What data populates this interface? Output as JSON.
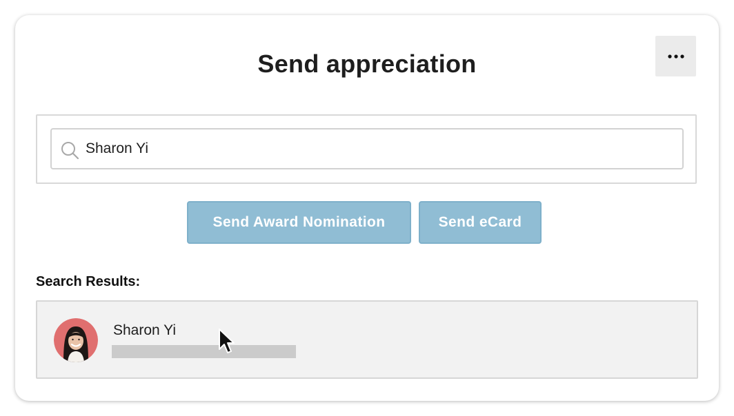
{
  "dialog": {
    "title": "Send appreciation",
    "more_icon": "ellipsis-icon"
  },
  "search": {
    "value": "Sharon Yi",
    "icon": "search-icon"
  },
  "actions": {
    "award_label": "Send Award Nomination",
    "ecard_label": "Send eCard",
    "button_color": "#90bdd4"
  },
  "results": {
    "label": "Search Results:",
    "items": [
      {
        "name": "Sharon Yi",
        "avatar_icon": "avatar-photo",
        "avatar_bg": "#e06f6f"
      }
    ]
  }
}
